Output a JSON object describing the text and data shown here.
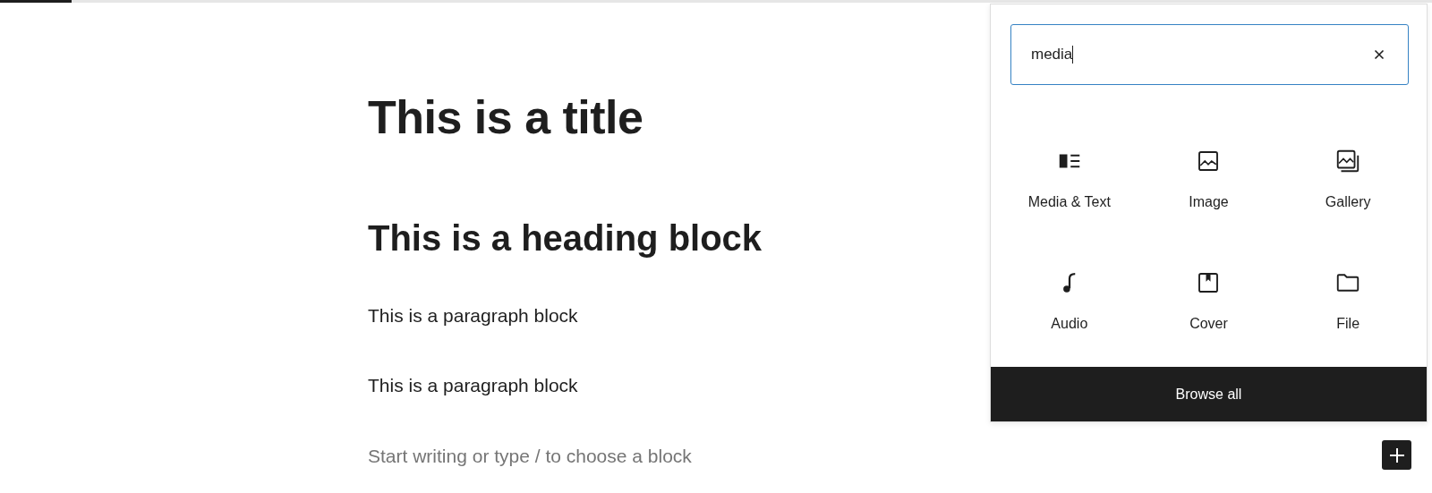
{
  "editor": {
    "title": "This is a title",
    "blocks": [
      {
        "kind": "heading",
        "text": "This is a heading block"
      },
      {
        "kind": "paragraph",
        "text": "This is a paragraph block"
      },
      {
        "kind": "paragraph",
        "text": "This is a paragraph block"
      }
    ],
    "placeholder": "Start writing or type / to choose a block"
  },
  "inserter": {
    "search": {
      "value": "media"
    },
    "blocks": [
      {
        "label": "Media & Text"
      },
      {
        "label": "Image"
      },
      {
        "label": "Gallery"
      },
      {
        "label": "Audio"
      },
      {
        "label": "Cover"
      },
      {
        "label": "File"
      }
    ],
    "browse_all": "Browse all"
  }
}
